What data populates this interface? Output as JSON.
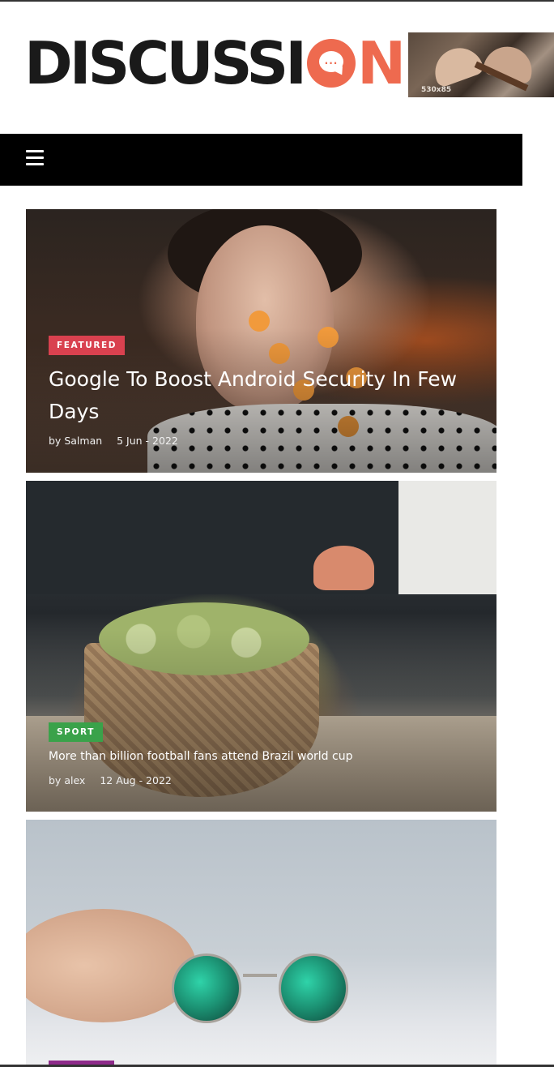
{
  "header": {
    "logo_prefix": "DISCUSSI",
    "logo_dots": "...",
    "logo_suffix": "N",
    "ad_label": "530x85"
  },
  "nav": {
    "menu_icon": "hamburger-icon"
  },
  "posts": [
    {
      "category": "FEATURED",
      "category_color": "#d9414f",
      "title": "Google To Boost Android Security In Few Days",
      "author_prefix": "by",
      "author": "Salman",
      "date": "5 Jun - 2022"
    },
    {
      "category": "SPORT",
      "category_color": "#3aa24a",
      "title": "More than billion football fans attend Brazil world cup",
      "author_prefix": "by",
      "author": "alex",
      "date": "12 Aug - 2022"
    },
    {
      "category_color": "#8e2a8a"
    }
  ],
  "colors": {
    "accent": "#ee6a4f",
    "nav_bg": "#000000"
  }
}
